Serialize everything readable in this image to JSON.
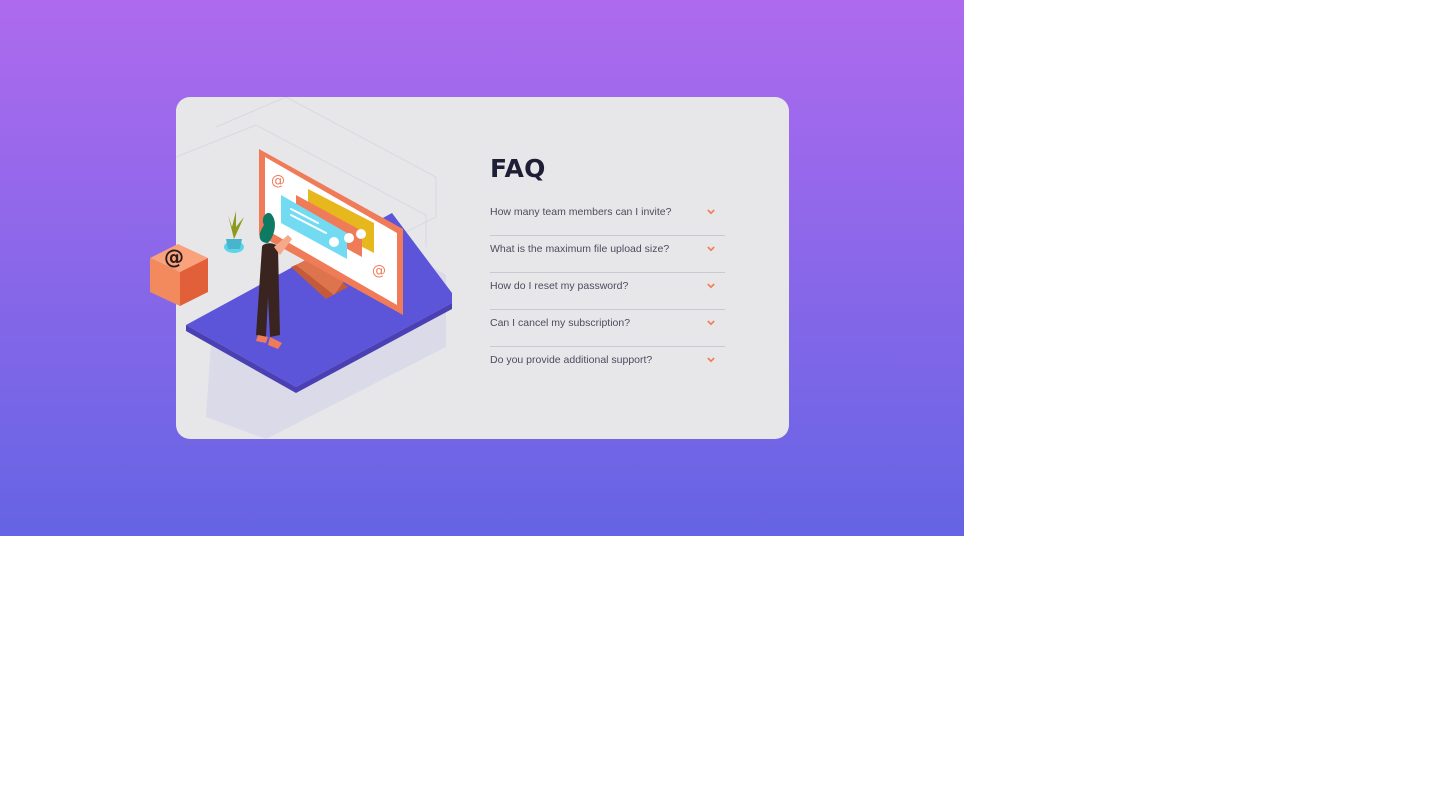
{
  "faq": {
    "title": "FAQ",
    "items": [
      {
        "question": "How many team members can I invite?",
        "icon": "chevron-down-icon"
      },
      {
        "question": "What is the maximum file upload size?",
        "icon": "chevron-down-icon"
      },
      {
        "question": "How do I reset my password?",
        "icon": "chevron-down-icon"
      },
      {
        "question": "Can I cancel my subscription?",
        "icon": "chevron-down-icon"
      },
      {
        "question": "Do you provide additional support?",
        "icon": "chevron-down-icon"
      }
    ]
  },
  "colors": {
    "background_top": "#ae6aee",
    "background_bottom": "#6564e4",
    "card": "#e7e7e9",
    "title": "#1e1f36",
    "question_text": "#4b4c5f",
    "accent": "#f47b56",
    "divider": "#c9c9d0"
  }
}
